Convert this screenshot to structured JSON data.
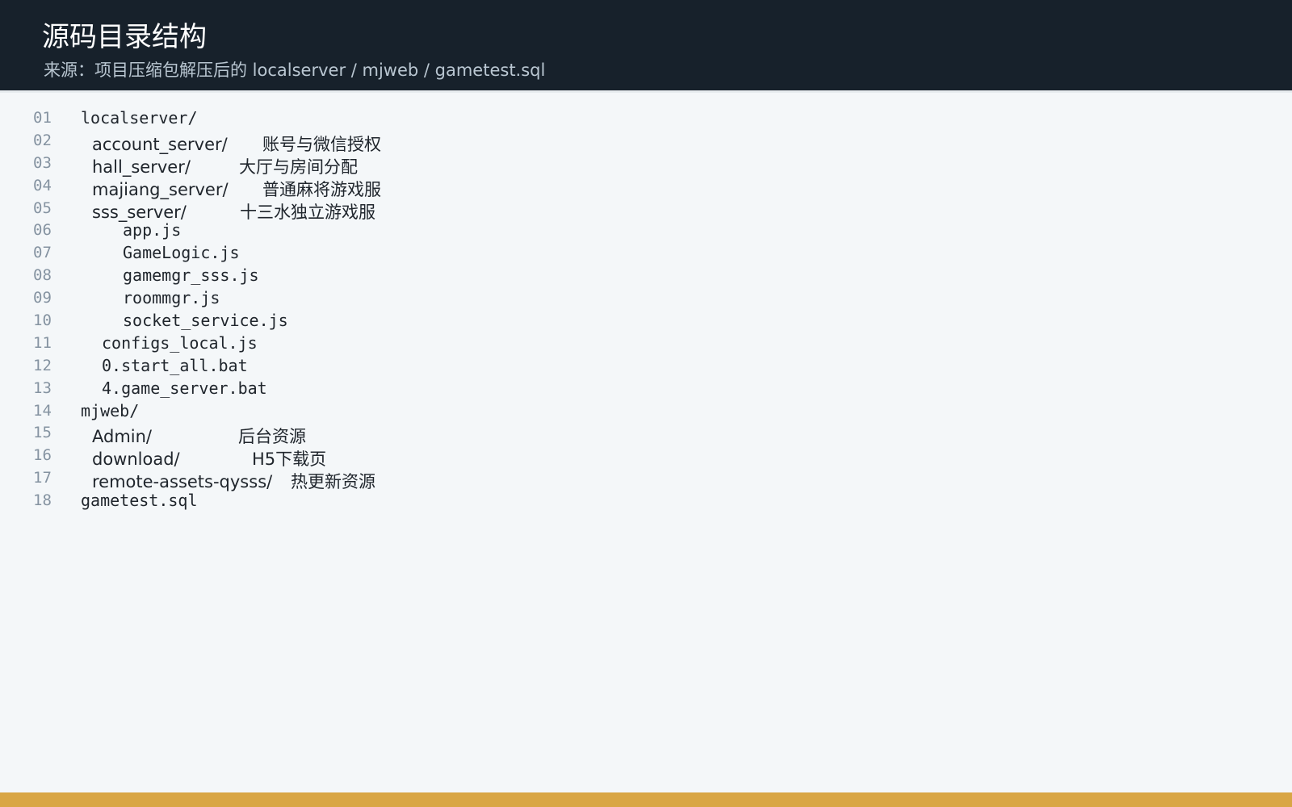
{
  "header": {
    "title": "源码目录结构",
    "subtitle": "来源：项目压缩包解压后的 localserver / mjweb / gametest.sql"
  },
  "tree": [
    {
      "num": "01",
      "text": "localserver/"
    },
    {
      "num": "02",
      "name": "account_server/",
      "desc": "账号与微信授权"
    },
    {
      "num": "03",
      "name": "hall_server/",
      "desc": "大厅与房间分配"
    },
    {
      "num": "04",
      "name": "majiang_server/",
      "desc": "普通麻将游戏服"
    },
    {
      "num": "05",
      "name": "sss_server/",
      "desc": "十三水独立游戏服"
    },
    {
      "num": "06",
      "text": "app.js"
    },
    {
      "num": "07",
      "text": "GameLogic.js"
    },
    {
      "num": "08",
      "text": "gamemgr_sss.js"
    },
    {
      "num": "09",
      "text": "roommgr.js"
    },
    {
      "num": "10",
      "text": "socket_service.js"
    },
    {
      "num": "11",
      "text": "configs_local.js"
    },
    {
      "num": "12",
      "text": "0.start_all.bat"
    },
    {
      "num": "13",
      "text": "4.game_server.bat"
    },
    {
      "num": "14",
      "text": "mjweb/"
    },
    {
      "num": "15",
      "name": "Admin/",
      "desc": "后台资源"
    },
    {
      "num": "16",
      "name": "download/",
      "desc": "H5下载页"
    },
    {
      "num": "17",
      "name": "remote-assets-qysss/",
      "desc": "热更新资源"
    },
    {
      "num": "18",
      "text": "gametest.sql"
    }
  ],
  "colors": {
    "header_bg": "#17212b",
    "page_bg": "#f4f7f9",
    "accent_bar": "#d9a645"
  }
}
